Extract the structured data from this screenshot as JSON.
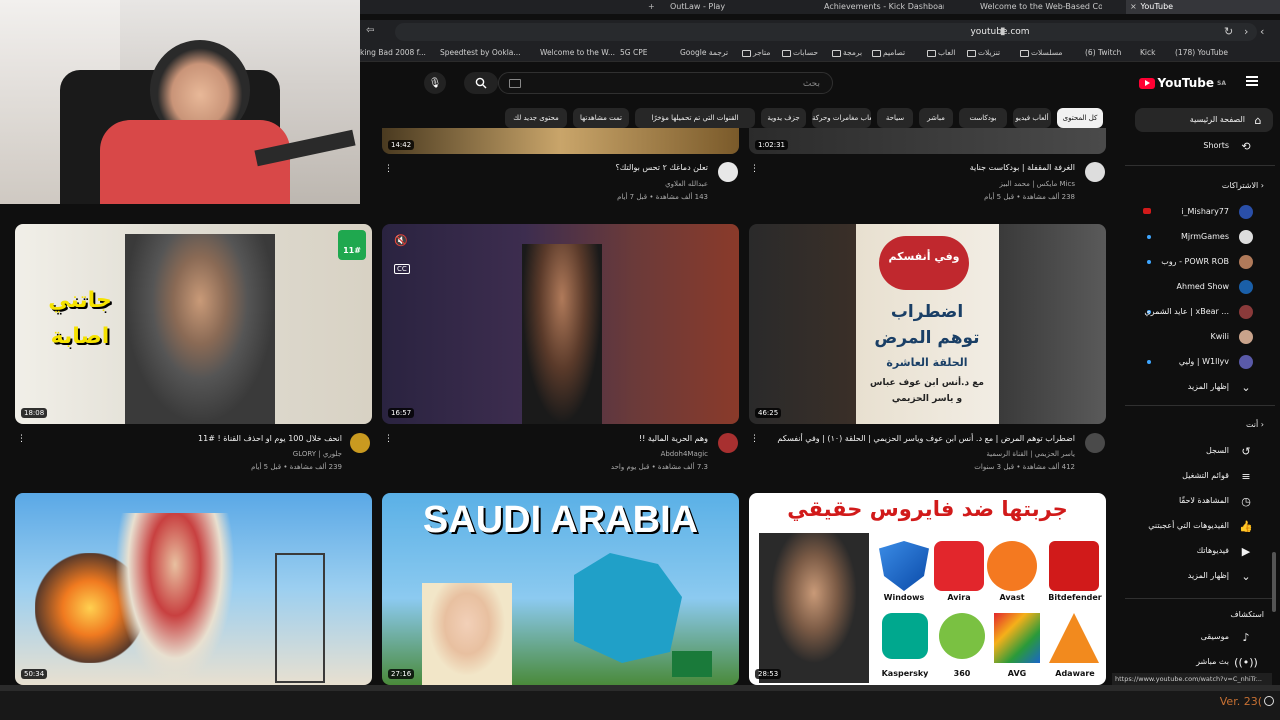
{
  "browser": {
    "tabs": [
      {
        "label": "OutLaw - Play"
      },
      {
        "label": "Achievements - Kick Dashboard"
      },
      {
        "label": "Welcome to the Web-Based Config"
      },
      {
        "label": "YouTube"
      }
    ],
    "url": "youtube.com",
    "bookmarks": [
      {
        "label": "king Bad 2008 f..."
      },
      {
        "label": "Speedtest by Ookla..."
      },
      {
        "label": "Welcome to the W..."
      },
      {
        "label": "5G CPE"
      },
      {
        "label": "Google ترجمة"
      },
      {
        "label": "متاجر"
      },
      {
        "label": "حسابات"
      },
      {
        "label": "برمجة"
      },
      {
        "label": "تصاميم"
      },
      {
        "label": "العاب"
      },
      {
        "label": "تنزيلات"
      },
      {
        "label": "مسلسلات"
      },
      {
        "label": "(6) Twitch"
      },
      {
        "label": "Kick"
      },
      {
        "label": "(178) YouTube"
      }
    ],
    "status_url": "https://www.youtube.com/watch?v=C_nhiTr..."
  },
  "youtube": {
    "logo": "YouTube",
    "logo_region": "SA",
    "search_placeholder": "بحث",
    "chips": [
      {
        "label": "كل المحتوى",
        "selected": true
      },
      {
        "label": "ألعاب فيديو"
      },
      {
        "label": "بودكاست"
      },
      {
        "label": "مباشر"
      },
      {
        "label": "سياحة"
      },
      {
        "label": "ألعاب مغامرات وحركة"
      },
      {
        "label": "جزف يدوية"
      },
      {
        "label": "القنوات التي تم تحميلها مؤخرًا"
      },
      {
        "label": "تمت مشاهدتها"
      },
      {
        "label": "محتوى جديد لك"
      }
    ]
  },
  "sidebar": {
    "home": "الصفحة الرئيسية",
    "shorts": "Shorts",
    "subscriptions_header": "الاشتراكات",
    "subscriptions": [
      {
        "label": "i_Mishary77",
        "color": "#2a4fa8"
      },
      {
        "label": "MjrmGames",
        "color": "#ddd"
      },
      {
        "label": "روب - POWR ROB",
        "color": "#b07a5a"
      },
      {
        "label": "Ahmed Show",
        "color": "#1a5fa8"
      },
      {
        "label": "عايد الشمري | xBear ...",
        "color": "#8a3a3a"
      },
      {
        "label": "Kwili",
        "color": "#c9a38b"
      },
      {
        "label": "وليي | W1llyv",
        "color": "#5a5aa8"
      }
    ],
    "show_more_subs": "إظهار المزيد",
    "you_header": "أنت",
    "you_items": [
      {
        "label": "السجل",
        "icon": "history-icon"
      },
      {
        "label": "قوائم التشغيل",
        "icon": "playlist-icon"
      },
      {
        "label": "المشاهدة لاحقًا",
        "icon": "watch-later-icon"
      },
      {
        "label": "الفيديوهات التي أعجبتني",
        "icon": "like-icon"
      },
      {
        "label": "فيديوهاتك",
        "icon": "your-videos-icon"
      },
      {
        "label": "إظهار المزيد",
        "icon": "chevron-down-icon"
      }
    ],
    "explore_header": "استكشاف",
    "explore_items": [
      {
        "label": "موسيقى",
        "icon": "music-icon"
      },
      {
        "label": "بث مباشر",
        "icon": "live-icon"
      }
    ]
  },
  "videos": {
    "row0": [
      {
        "duration": "1:02:31",
        "title": "الغرفة المقفلة | بودكاست جناية",
        "channel": "Mics مايكس | محمد البيز",
        "meta": "238 ألف مشاهدة • قبل 5 أيام"
      },
      {
        "duration": "14:42",
        "title": "تعلن دماغك ٢ تحس بوالتك؟",
        "channel": "عبدالله العلاوي",
        "meta": "143 ألف مشاهدة • قبل 7 أيام"
      }
    ],
    "row1": [
      {
        "duration": "46:25",
        "title": "اضطراب توهم المرض | مع د. أنس ابن عوف وياسر الحزيمي | الحلقة (١٠) | وفي أنفسكم",
        "channel": "ياسر الحزيمي | القناة الرسمية",
        "meta": "412 ألف مشاهدة • قبل 3 سنوات",
        "overlay_logo": "وفي أنفسكم",
        "overlay_lines": [
          "اضطراب",
          "توهم المرض",
          "الحلقة العاشرة",
          "مع د.أنس ابن عوف عباس",
          "و ياسر الحزيمي"
        ]
      },
      {
        "duration": "16:57",
        "title": "وهم الحرية المالية !!",
        "channel": "Abdoh4Magic",
        "meta": "7.3 ألف مشاهدة • قبل يوم واحد",
        "player_caption": "CC"
      },
      {
        "duration": "18:08",
        "title": "انحف خلال 100 يوم او احذف القناة ! #11",
        "channel": "جلوري | GLORY",
        "meta": "239 ألف مشاهدة • قبل 5 أيام",
        "overlay_lines": [
          "جاتني",
          "اصابة"
        ],
        "badge": "11#"
      }
    ],
    "row2": [
      {
        "duration": "28:53",
        "overlay_title": "جربتها ضد فايروس حقيقي",
        "antivirus": [
          "Bitdefender",
          "Avast",
          "Avira",
          "Windows",
          "Adaware",
          "AVG",
          "360",
          "Kaspersky"
        ]
      },
      {
        "duration": "27:16",
        "overlay_title": "SAUDI ARABIA"
      },
      {
        "duration": "50:34"
      }
    ]
  },
  "footer": {
    "version": "Ver. 23("
  }
}
